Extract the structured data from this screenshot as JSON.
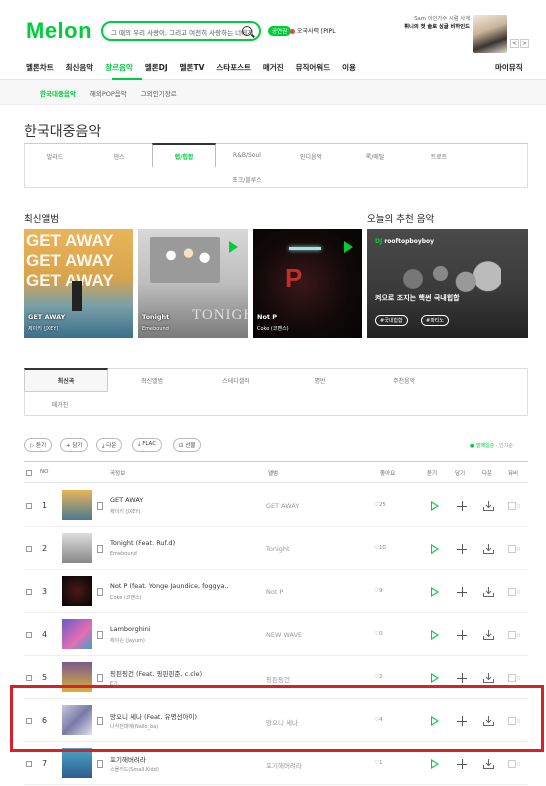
{
  "header": {
    "logo": "Melon",
    "search_text": "그 때의 우리 사랑이, 그리고 여전히 사랑하는 너에게",
    "ticket_badge": "공연권",
    "user_status": "오국사력 [PIPL",
    "ad_line1": "Sam 이안가수 시럼 사계",
    "ad_line2": "휘니의 첫 솔로 싱글 비하인드",
    "ad_prev": "<",
    "ad_next": ">"
  },
  "gnb": {
    "items": [
      "멜론차트",
      "최신음악",
      "장르음악",
      "멜론DJ",
      "멜론TV",
      "스타포스트",
      "매거진",
      "뮤직어워드",
      "이용"
    ],
    "active_index": 2,
    "mymusic": "마이뮤직"
  },
  "subnav": {
    "items": [
      "한국대중음악",
      "해외POP음악",
      "그외인기장르"
    ],
    "active_index": 0
  },
  "page_title": "한국대중음악",
  "genres": {
    "items": [
      "발라드",
      "댄스",
      "랩/힙합",
      "R&B/Soul",
      "인디음악",
      "록/메탈",
      "트로트",
      "포크/블루스"
    ],
    "active_index": 2
  },
  "sections": {
    "latest_albums": "최신앨범",
    "recommend": "오늘의 추천 음악"
  },
  "albums": [
    {
      "title": "GET AWAY",
      "artist": "제이키 (JXEY)",
      "art_text": "GET AWAY"
    },
    {
      "title": "Tonight",
      "artist": "Emebound",
      "art_text": "TONIGHT"
    },
    {
      "title": "Not P",
      "artist": "Coke (코멘스)",
      "art_text": "P"
    }
  ],
  "recommend": {
    "brand": "DJ",
    "channel": "rooftopboyboy",
    "caption": "켜으로 조지는 핵썬 국내힙합",
    "tags": [
      "#국내힙합",
      "#파티노"
    ]
  },
  "list_tabs": {
    "items": [
      "최신곡",
      "최신앨범",
      "스테디셀러",
      "명반",
      "주천음악",
      "매거진"
    ],
    "active_index": 0
  },
  "toolbar": {
    "buttons": [
      "듣기",
      "담기",
      "다운",
      "FLAC",
      "선물"
    ],
    "sort_latest": "발매일순",
    "sort_popular": "인기순"
  },
  "table": {
    "headers": {
      "no": "NO",
      "song": "곡정보",
      "album": "앨범",
      "like": "좋아요",
      "listen": "듣기",
      "add": "담기",
      "download": "다운",
      "mv": "뮤비"
    },
    "rows": [
      {
        "no": "1",
        "title": "GET AWAY",
        "artist": "제이키 (JXEY)",
        "album": "GET AWAY",
        "likes": "25",
        "mv": "0"
      },
      {
        "no": "2",
        "title": "Tonight (Feat. Ruf.d)",
        "artist": "Emebound",
        "album": "Tonight",
        "likes": "10",
        "mv": "0"
      },
      {
        "no": "3",
        "title": "Not P (feat. Yonge Jaundice, foggya..",
        "artist": "Coke (코멘스)",
        "album": "Not P",
        "likes": "9",
        "mv": "0"
      },
      {
        "no": "4",
        "title": "Lamborghini",
        "artist": "제이슨 (Jayum)",
        "album": "NEW WAVE",
        "likes": "0",
        "mv": "0"
      },
      {
        "no": "5",
        "title": "핑핀핑건 (Feat. 핑핀핀준, c.cle)",
        "artist": "E기",
        "album": "핑핀핑건",
        "likes": "2",
        "mv": "0"
      },
      {
        "no": "6",
        "title": "망오니 세나 (Feat. 유명선아이)",
        "artist": "나식천대에(Nallo_ba)",
        "album": "망오니 세나",
        "likes": "4",
        "mv": "0"
      },
      {
        "no": "7",
        "title": "포기해버려라",
        "artist": "스몰키드(Small Kidd)",
        "album": "포기해버려라",
        "likes": "1",
        "mv": "0"
      }
    ]
  },
  "colors": {
    "accent": "#00cd3c",
    "highlight": "#d82026"
  }
}
